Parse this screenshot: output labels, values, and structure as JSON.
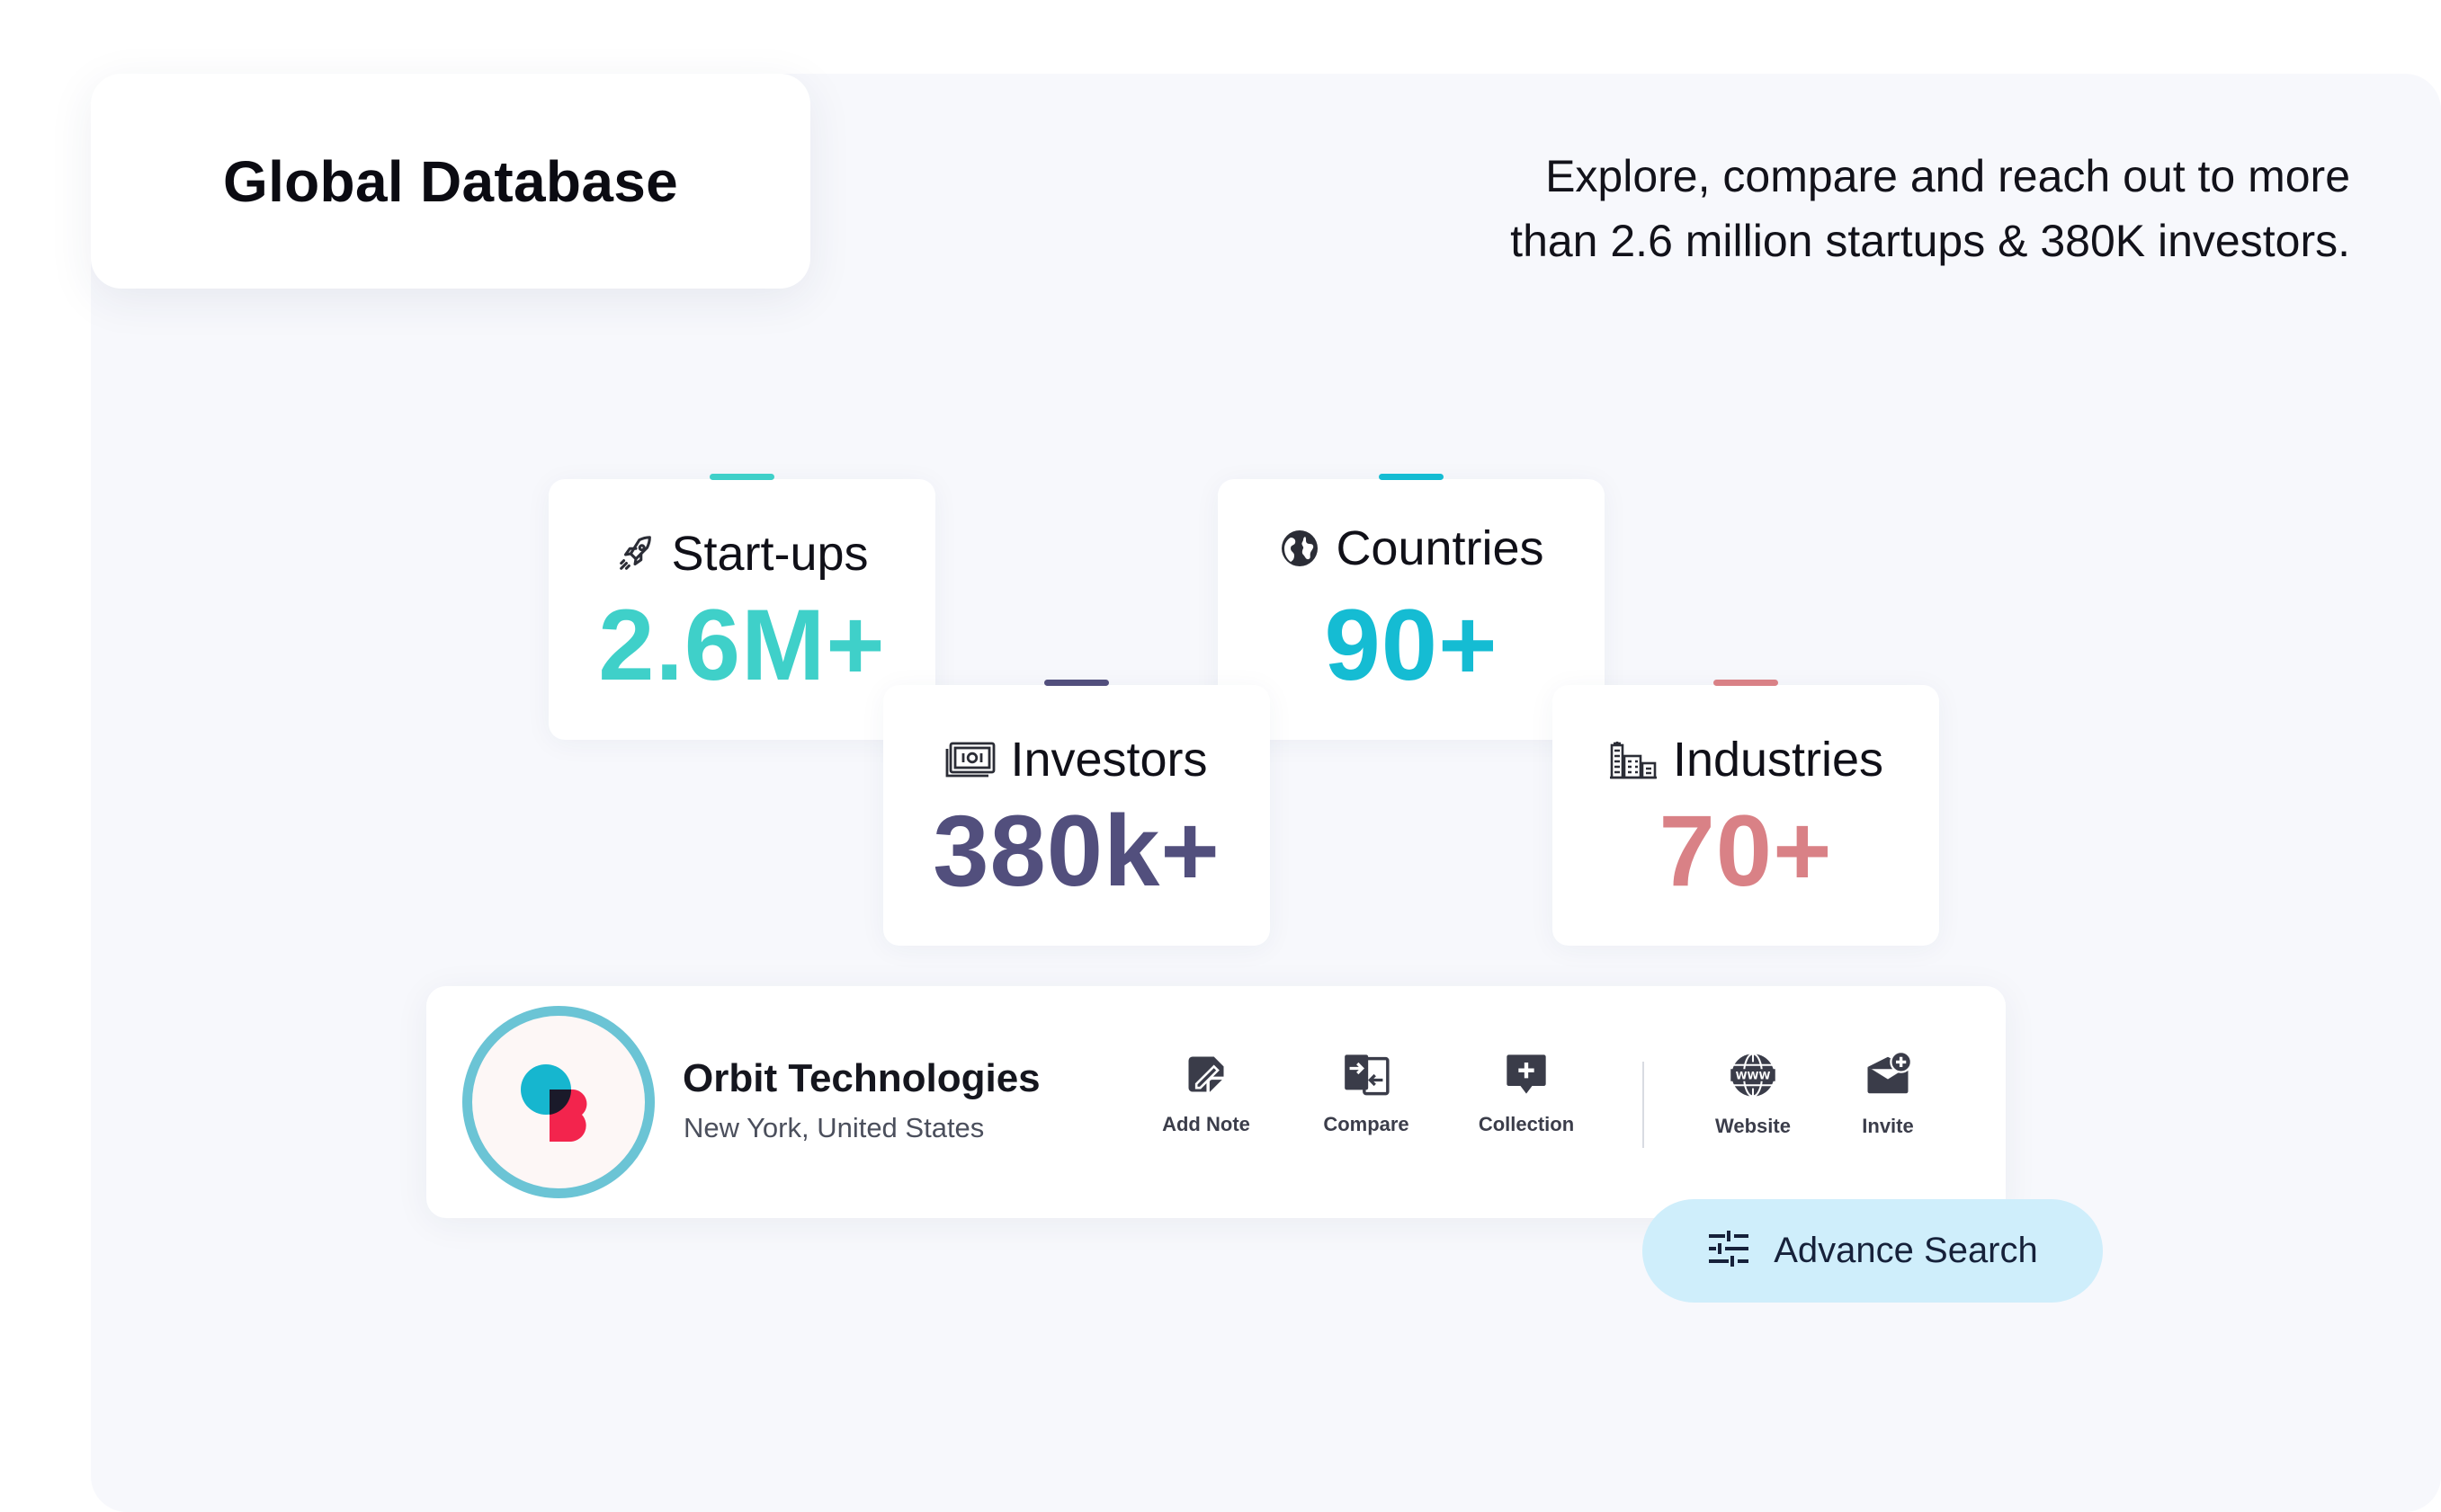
{
  "header": {
    "title": "Global Database",
    "tagline_line1": "Explore, compare and reach out to more",
    "tagline_line2": "than 2.6 million startups & 380K investors."
  },
  "stats": [
    {
      "key": "startups",
      "label": "Start-ups",
      "value": "2.6M+",
      "icon": "rocket-icon",
      "color": "#3fd0c9"
    },
    {
      "key": "countries",
      "label": "Countries",
      "value": "90+",
      "icon": "globe-icon",
      "color": "#15bcd3"
    },
    {
      "key": "investors",
      "label": "Investors",
      "value": "380k+",
      "icon": "money-bill-icon",
      "color": "#524f7d"
    },
    {
      "key": "industries",
      "label": "Industries",
      "value": "70+",
      "icon": "buildings-icon",
      "color": "#d98186"
    }
  ],
  "company": {
    "name": "Orbit Technologies",
    "location": "New York, United States",
    "actions": [
      {
        "label": "Add Note",
        "icon": "note-icon"
      },
      {
        "label": "Compare",
        "icon": "compare-icon"
      },
      {
        "label": "Collection",
        "icon": "add-collection-icon"
      },
      {
        "label": "Website",
        "icon": "www-globe-icon"
      },
      {
        "label": "Invite",
        "icon": "invite-mail-icon"
      }
    ]
  },
  "advance_search": {
    "label": "Advance Search",
    "icon": "sliders-icon"
  },
  "colors": {
    "panel_bg": "#f7f8fc",
    "avatar_ring": "#6bc4d5",
    "search_button_bg": "#cfeefb"
  }
}
